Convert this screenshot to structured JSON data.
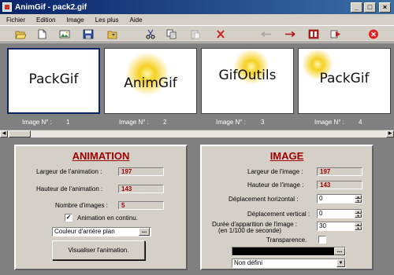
{
  "window": {
    "title": "AnimGif - pack2.gif",
    "min": "_",
    "max": "□",
    "close": "×"
  },
  "menu": [
    "Fichier",
    "Edition",
    "Image",
    "Les plus",
    "Aide"
  ],
  "toolbar": {
    "icons": [
      "open-folder-icon",
      "new-file-icon",
      "image-icon",
      "save-icon",
      "open-folder-2-icon",
      "cut-icon",
      "copy-icon",
      "paste-icon",
      "delete-icon",
      "arrow-left-icon",
      "arrow-right-icon",
      "frames-icon",
      "play-icon",
      "stop-icon"
    ]
  },
  "thumbnails": [
    {
      "text": "PackGif",
      "caption_label": "Image N° :",
      "number": "1"
    },
    {
      "text": "AnimGif",
      "caption_label": "Image N° :",
      "number": "2"
    },
    {
      "text": "GifOutils",
      "caption_label": "Image N° :",
      "number": "3"
    },
    {
      "text": "PackGif",
      "caption_label": "Image N° :",
      "number": "4"
    }
  ],
  "animation": {
    "title": "ANIMATION",
    "width_label": "Largeur de l'animation :",
    "width_value": "197",
    "height_label": "Hauteur de l'animation :",
    "height_value": "143",
    "count_label": "Nombre d'images :",
    "count_value": "5",
    "loop_label": "Animation en continu.",
    "loop_checked": true,
    "bg_color_field": "Couleur d'arrière plan",
    "preview_button": "Visualiser l'animation."
  },
  "image": {
    "title": "IMAGE",
    "width_label": "Largeur de l'image :",
    "width_value": "197",
    "height_label": "Hauteur de l'image :",
    "height_value": "143",
    "hshift_label": "Déplacement horizontal :",
    "hshift_value": "0",
    "vshift_label": "Déplacement vertical :",
    "vshift_value": "0",
    "duration_label_1": "Durée d'apparition de l'image :",
    "duration_label_2": "(en 1/100 de seconde)",
    "duration_value": "30",
    "transparency_label": "Transparence.",
    "transparency_checked": false,
    "transparency_color": "#000000",
    "disposal_value": "Non défini"
  },
  "colors": {
    "titlebar_start": "#0a246a",
    "titlebar_end": "#3a6ea5",
    "heading": "#a00000",
    "value_text": "#a00000"
  }
}
